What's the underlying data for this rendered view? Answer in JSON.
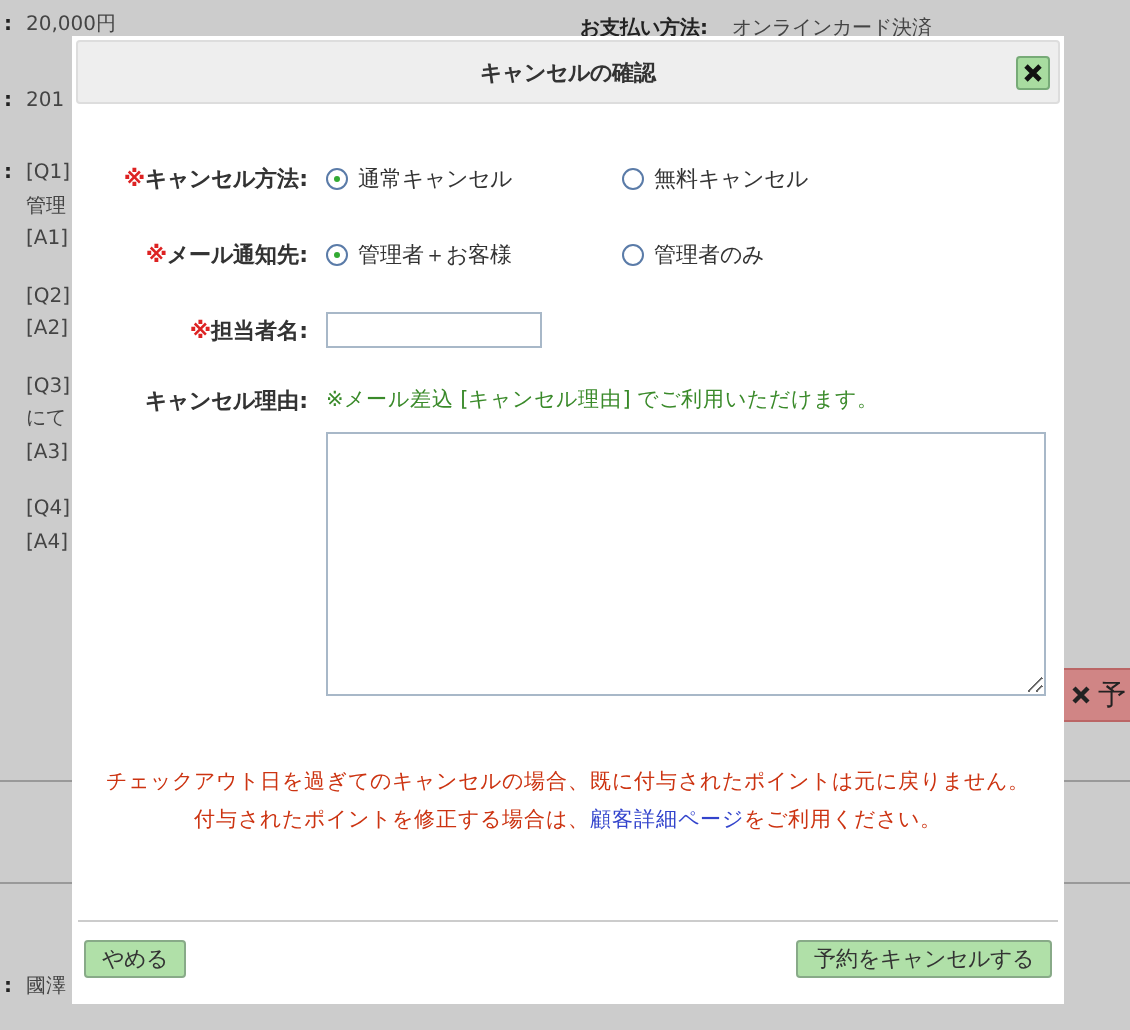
{
  "background": {
    "top_right": {
      "label": "お支払い方法:",
      "value": "オンラインカード決済"
    },
    "groups": [
      {
        "colon": ":",
        "blocks": [
          [
            "20,000円"
          ]
        ]
      },
      {
        "colon": ":",
        "blocks": [
          [
            "201"
          ]
        ]
      },
      {
        "colon": ":",
        "blocks": [
          [
            "[Q1]",
            "管理",
            "[A1]"
          ],
          [
            "[Q2]",
            "[A2]"
          ],
          [
            "[Q3]",
            "にて",
            "[A3]"
          ],
          [
            "[Q4]",
            "[A4]"
          ]
        ]
      },
      {
        "colon": ":",
        "blocks": [
          [
            "國澤"
          ]
        ]
      }
    ],
    "side_button": {
      "label": "予"
    }
  },
  "dialog": {
    "title": "キャンセルの確認",
    "fields": [
      {
        "kind": "radio",
        "mark": "※",
        "label": "キャンセル方法:",
        "options": [
          {
            "label": "通常キャンセル",
            "selected": true
          },
          {
            "label": "無料キャンセル",
            "selected": false
          }
        ]
      },
      {
        "kind": "radio",
        "mark": "※",
        "label": "メール通知先:",
        "options": [
          {
            "label": "管理者＋お客様",
            "selected": true
          },
          {
            "label": "管理者のみ",
            "selected": false
          }
        ]
      },
      {
        "kind": "text",
        "mark": "※",
        "label": "担当者名:"
      },
      {
        "kind": "textarea",
        "label": "キャンセル理由:",
        "hint": "※メール差込 [キャンセル理由] でご利用いただけます。"
      }
    ],
    "notice": {
      "line": "チェックアウト日を過ぎてのキャンセルの場合、既に付与されたポイントは元に戻りません。",
      "before": "付与されたポイントを修正する場合は、",
      "link": "顧客詳細ページ",
      "after": "をご利用ください。"
    },
    "buttons": [
      "やめる",
      "予約をキャンセルする"
    ]
  }
}
